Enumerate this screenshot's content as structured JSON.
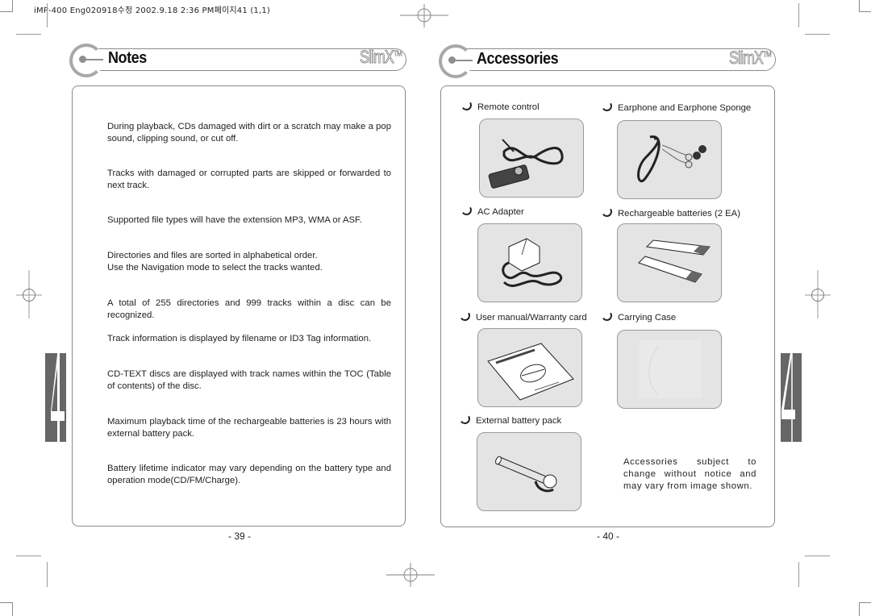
{
  "print_slug": "iMP-400 Eng020918수정  2002.9.18 2:36 PM페이지41 (1,1)",
  "left_page": {
    "title": "Notes",
    "brand": "SlimX",
    "brand_tm": "TM",
    "notes": [
      "During playback, CDs damaged with dirt or a scratch may make a pop sound, clipping sound, or cut off.",
      "Tracks with damaged or corrupted parts are skipped or forwarded to next track.",
      "Supported file types will have the extension MP3, WMA or ASF.",
      "Directories and files are sorted in alphabetical order.\nUse the Navigation mode to select the tracks wanted.",
      "A total of 255 directories and 999 tracks within a disc can be recognized.",
      "Track information is displayed by filename or ID3 Tag information.",
      "CD-TEXT discs are displayed with track names within the TOC (Table of contents) of the disc.",
      "Maximum playback time of the rechargeable batteries is 23 hours with external battery pack.",
      "Battery lifetime indicator may vary depending on the battery type and operation mode(CD/FM/Charge)."
    ],
    "page_number": "- 39 -",
    "chapter_number": "4"
  },
  "right_page": {
    "title": "Accessories",
    "brand": "SlimX",
    "brand_tm": "TM",
    "items": [
      {
        "label": "Remote control",
        "icon": "remote-control-image"
      },
      {
        "label": "Earphone and Earphone Sponge",
        "icon": "earphone-image"
      },
      {
        "label": "AC Adapter",
        "icon": "ac-adapter-image"
      },
      {
        "label": "Rechargeable batteries (2 EA)",
        "icon": "batteries-image"
      },
      {
        "label": "User manual/Warranty card",
        "icon": "user-manual-image"
      },
      {
        "label": "Carrying Case",
        "icon": "carrying-case-image"
      },
      {
        "label": "External battery pack",
        "icon": "battery-pack-image"
      }
    ],
    "disclaimer": "Accessories subject to change without notice and may vary from image shown.",
    "page_number": "- 40 -",
    "chapter_number": "4"
  },
  "colors": {
    "frame_gray": "#8a8a8a",
    "image_bg": "#e4e4e4",
    "chapter_tab": "#666666"
  }
}
